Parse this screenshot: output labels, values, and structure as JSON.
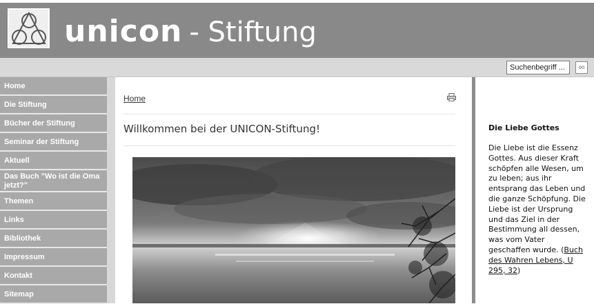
{
  "header": {
    "brand_bold": "unicon",
    "brand_rest": "- Stiftung"
  },
  "search": {
    "placeholder": "Suchenbegriff ...",
    "button_label": "oo"
  },
  "sidebar": {
    "items": [
      {
        "label": "Home"
      },
      {
        "label": "Die Stiftung"
      },
      {
        "label": "Bücher der Stiftung"
      },
      {
        "label": "Seminar der Stiftung"
      },
      {
        "label": "Aktuell"
      },
      {
        "label": "Das Buch \"Wo ist die Oma jetzt?\""
      },
      {
        "label": "Themen"
      },
      {
        "label": "Links"
      },
      {
        "label": "Bibliothek"
      },
      {
        "label": "Impressum"
      },
      {
        "label": "Kontakt"
      },
      {
        "label": "Sitemap"
      }
    ]
  },
  "main": {
    "breadcrumb": "Home",
    "title": "Willkommen bei der UNICON-Stiftung!"
  },
  "aside": {
    "title": "Die Liebe Gottes",
    "text": "Die Liebe ist die Essenz Gottes. Aus dieser Kraft schöpfen alle Wesen, um zu leben; aus ihr entsprang das Leben und die ganze Schöpfung. Die Liebe ist der Ursprung und das Ziel in der Bestimmung all dessen, was vom Vater geschaffen wurde.",
    "source_open": "(",
    "source_link": "Buch des Wahren Lebens, U 295, 32",
    "source_close": ")"
  },
  "colors": {
    "header_bg": "#898989",
    "nav_item_bg": "#a9a9a9",
    "sidebar_bg": "#d7d7d7",
    "searchbar_bg": "#d9d9d9"
  },
  "icons": {
    "logo": "triangle-circles-logo-icon",
    "print": "printer-icon"
  }
}
